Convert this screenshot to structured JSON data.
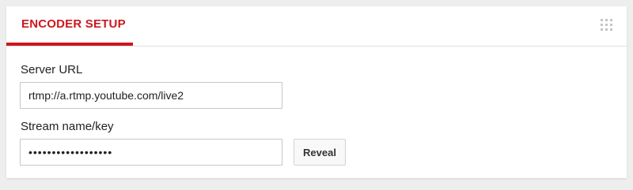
{
  "header": {
    "tab_label": "ENCODER SETUP",
    "drag_handle_icon": "grip-dots-icon"
  },
  "server": {
    "label": "Server URL",
    "value": "rtmp://a.rtmp.youtube.com/live2"
  },
  "stream": {
    "label": "Stream name/key",
    "value": "••••••••••••••••••",
    "reveal_label": "Reveal"
  },
  "colors": {
    "accent": "#cc181e",
    "background": "#eeeeee",
    "card": "#ffffff"
  }
}
